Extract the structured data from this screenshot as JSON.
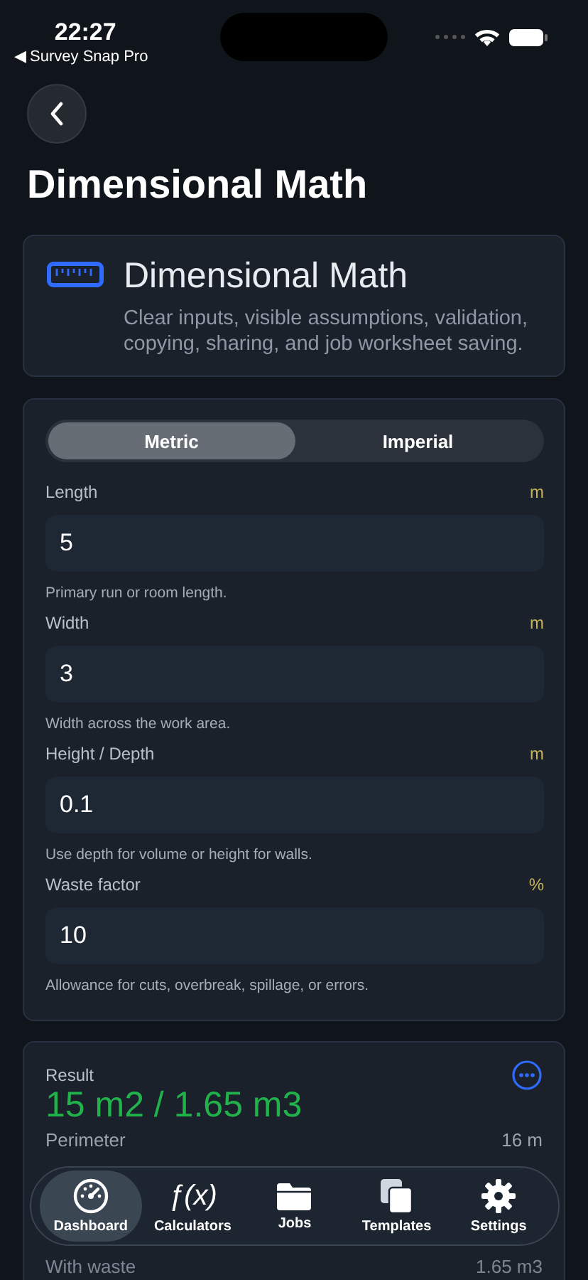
{
  "status_bar": {
    "time": "22:27",
    "back_app": "◀ Survey Snap Pro"
  },
  "title": "Dimensional Math",
  "intro": {
    "title": "Dimensional Math",
    "description": "Clear inputs, visible assumptions, validation, copying, sharing, and job worksheet saving."
  },
  "unit_tabs": [
    {
      "label": "Metric",
      "selected": true
    },
    {
      "label": "Imperial",
      "selected": false
    }
  ],
  "fields": [
    {
      "label": "Length",
      "unit": "m",
      "value": "5",
      "hint": "Primary run or room length."
    },
    {
      "label": "Width",
      "unit": "m",
      "value": "3",
      "hint": "Width across the work area."
    },
    {
      "label": "Height / Depth",
      "unit": "m",
      "value": "0.1",
      "hint": "Use depth for volume or height for walls."
    },
    {
      "label": "Waste factor",
      "unit": "%",
      "value": "10",
      "hint": "Allowance for cuts, overbreak, spillage, or errors."
    }
  ],
  "result": {
    "label": "Result",
    "value": "15 m2 / 1.65 m3",
    "rows": [
      {
        "label": "Perimeter",
        "value": "16 m"
      },
      {
        "label": "With waste",
        "value": "1.65 m3"
      }
    ]
  },
  "tab_bar": [
    {
      "label": "Dashboard",
      "selected": true
    },
    {
      "label": "Calculators",
      "selected": false,
      "glyph": "ƒ(x)"
    },
    {
      "label": "Jobs",
      "selected": false
    },
    {
      "label": "Templates",
      "selected": false
    },
    {
      "label": "Settings",
      "selected": false
    }
  ]
}
